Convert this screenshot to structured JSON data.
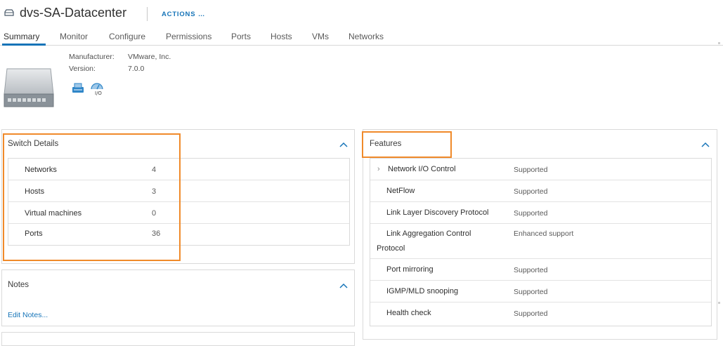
{
  "header": {
    "title": "dvs-SA-Datacenter",
    "actions_label": "ACTIONS"
  },
  "tabs": [
    {
      "label": "Summary"
    },
    {
      "label": "Monitor"
    },
    {
      "label": "Configure"
    },
    {
      "label": "Permissions"
    },
    {
      "label": "Ports"
    },
    {
      "label": "Hosts"
    },
    {
      "label": "VMs"
    },
    {
      "label": "Networks"
    }
  ],
  "info": {
    "manufacturer_label": "Manufacturer:",
    "manufacturer_value": "VMware, Inc.",
    "version_label": "Version:",
    "version_value": "7.0.0"
  },
  "switch_details": {
    "title": "Switch Details",
    "rows": [
      {
        "label": "Networks",
        "value": "4"
      },
      {
        "label": "Hosts",
        "value": "3"
      },
      {
        "label": "Virtual machines",
        "value": "0"
      },
      {
        "label": "Ports",
        "value": "36"
      }
    ]
  },
  "notes": {
    "title": "Notes",
    "edit_link": "Edit Notes..."
  },
  "features": {
    "title": "Features",
    "rows": [
      {
        "name": "Network I/O Control",
        "status": "Supported"
      },
      {
        "name": "NetFlow",
        "status": "Supported"
      },
      {
        "name": "Link Layer Discovery Protocol",
        "status": "Supported"
      },
      {
        "name_line1": "Link Aggregation Control",
        "name_line2": "Protocol",
        "status": "Enhanced support"
      },
      {
        "name": "Port mirroring",
        "status": "Supported"
      },
      {
        "name": "IGMP/MLD snooping",
        "status": "Supported"
      },
      {
        "name": "Health check",
        "status": "Supported"
      }
    ]
  },
  "colors": {
    "accent": "#1674b8",
    "highlight": "#f08a2a"
  }
}
